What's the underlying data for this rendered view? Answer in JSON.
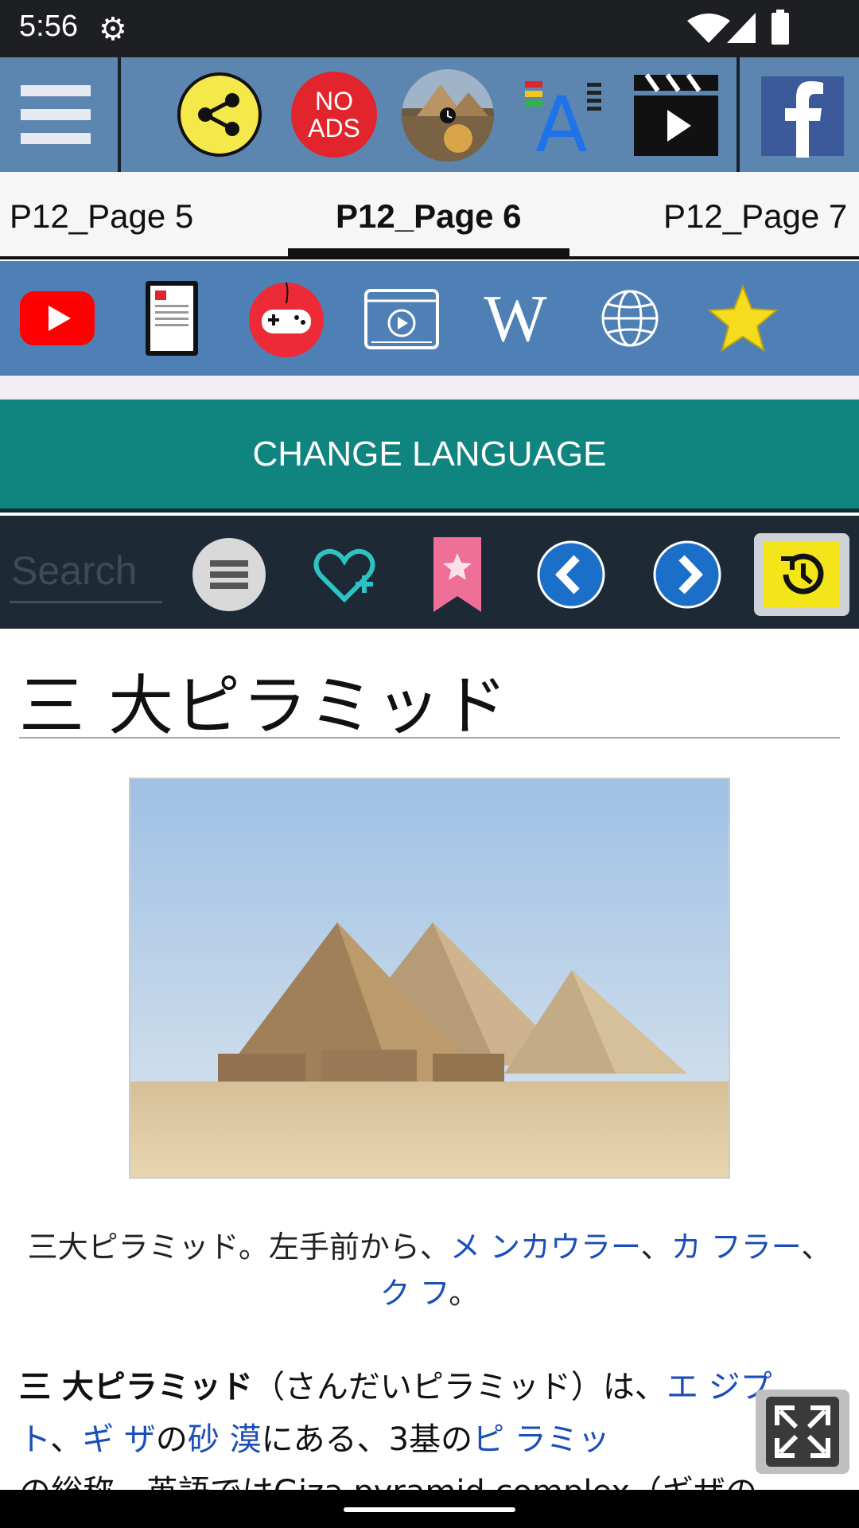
{
  "status": {
    "time": "5:56"
  },
  "tabs": [
    "P12_Page 5",
    "P12_Page 6",
    "P12_Page 7"
  ],
  "toolbar": {
    "no_ads_line1": "NO",
    "no_ads_line2": "ADS"
  },
  "bar2": {
    "wikipedia_letter": "W"
  },
  "change_language": "CHANGE LANGUAGE",
  "search": {
    "placeholder": "Search"
  },
  "article": {
    "title": "三 大ピラミッド",
    "caption": {
      "p1": "三大ピラミッド。左手前から、",
      "link1": "メ ンカウラー",
      "sep1": "、",
      "link2": "カ フラー",
      "sep2": "、",
      "link3": "ク フ",
      "end": "。"
    },
    "para": {
      "bold": "三 大ピラミッド",
      "t1": "（さんだいピラミッド）は、",
      "link1": "エ ジプト",
      "t2": "、",
      "link2": "ギ ザ",
      "t3": "の",
      "link3": "砂 漠",
      "t4": "にある、3基の",
      "link4": "ピ ラミッ",
      "line3": "の総称。英語ではGiza pyramid complex（ギザの"
    }
  },
  "colors": {
    "toolbar": "#5c86b0",
    "bar2": "#4f80b5",
    "change_language": "#108580",
    "search_bar": "#1d2a36",
    "link": "#1a4eb8"
  }
}
